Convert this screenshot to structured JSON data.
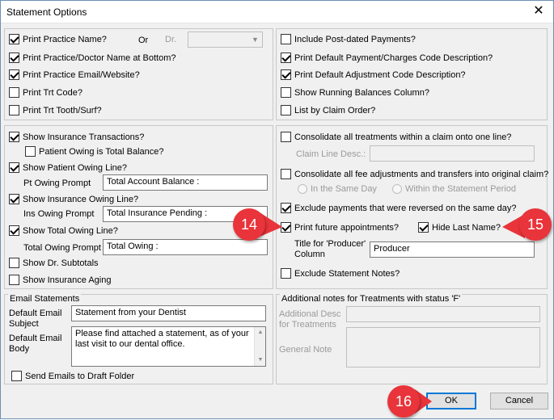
{
  "window": {
    "title": "Statement Options"
  },
  "top_left": {
    "print_practice_name": {
      "label": "Print Practice Name?",
      "checked": true
    },
    "or_label": "Or",
    "dr_label": "Dr.",
    "print_practice_doctor_bottom": {
      "label": "Print Practice/Doctor Name at Bottom?",
      "checked": true
    },
    "print_practice_email": {
      "label": "Print Practice Email/Website?",
      "checked": true
    },
    "print_trt_code": {
      "label": "Print Trt Code?",
      "checked": false
    },
    "print_trt_tooth": {
      "label": "Print Trt Tooth/Surf?",
      "checked": false
    }
  },
  "top_right": {
    "include_post_dated": {
      "label": "Include Post-dated Payments?",
      "checked": false
    },
    "print_default_payment": {
      "label": "Print Default Payment/Charges Code Description?",
      "checked": true
    },
    "print_default_adjustment": {
      "label": "Print Default Adjustment Code Description?",
      "checked": true
    },
    "show_running_balances": {
      "label": "Show Running Balances Column?",
      "checked": false
    },
    "list_by_claim_order": {
      "label": "List by Claim Order?",
      "checked": false
    }
  },
  "middle_left": {
    "show_insurance_transactions": {
      "label": "Show Insurance Transactions?",
      "checked": true
    },
    "patient_owing_total": {
      "label": "Patient Owing is Total Balance?",
      "checked": false
    },
    "show_patient_owing": {
      "label": "Show Patient Owing Line?",
      "checked": true
    },
    "pt_owing_prompt_label": "Pt Owing Prompt",
    "pt_owing_prompt_value": "Total Account Balance :",
    "show_insurance_owing": {
      "label": "Show Insurance Owing Line?",
      "checked": true
    },
    "ins_owing_prompt_label": "Ins Owing Prompt",
    "ins_owing_prompt_value": "Total Insurance Pending :",
    "show_total_owing": {
      "label": "Show Total Owing Line?",
      "checked": true
    },
    "total_owing_prompt_label": "Total Owing Prompt",
    "total_owing_prompt_value": "Total Owing :",
    "show_dr_subtotals": {
      "label": "Show Dr. Subtotals",
      "checked": false
    },
    "show_insurance_aging": {
      "label": "Show Insurance Aging",
      "checked": false
    }
  },
  "middle_right": {
    "consolidate_treatments": {
      "label": "Consolidate all treatments within a claim onto one line?",
      "checked": false
    },
    "claim_line_desc_label": "Claim Line Desc.:",
    "consolidate_fee_adjustments": {
      "label": "Consolidate all fee adjustments and transfers into original claim?",
      "checked": false
    },
    "radio_same_day": "In the Same Day",
    "radio_within_period": "Within the Statement Period",
    "exclude_reversed": {
      "label": "Exclude payments that were reversed on the same day?",
      "checked": true
    },
    "print_future_appointments": {
      "label": "Print future appointments?",
      "checked": true
    },
    "hide_last_name": {
      "label": "Hide Last Name?",
      "checked": true
    },
    "title_producer_label_1": "Title for 'Producer'",
    "title_producer_label_2": "Column",
    "title_producer_value": "Producer",
    "exclude_statement_notes": {
      "label": "Exclude Statement Notes?",
      "checked": false
    }
  },
  "email": {
    "group_title": "Email Statements",
    "subject_label_1": "Default Email",
    "subject_label_2": "Subject",
    "subject_value": "Statement from your Dentist",
    "body_label_1": "Default Email",
    "body_label_2": "Body",
    "body_value": "Please find attached a statement, as of your last visit to our dental office.",
    "send_to_draft": {
      "label": "Send Emails to Draft Folder",
      "checked": false
    }
  },
  "notes_f": {
    "group_title": "Additional notes for Treatments with status 'F'",
    "additional_desc_label_1": "Additional Desc",
    "additional_desc_label_2": "for Treatments",
    "general_note_label": "General Note"
  },
  "buttons": {
    "ok": "OK",
    "cancel": "Cancel"
  },
  "callouts": {
    "c14": "14",
    "c15": "15",
    "c16": "16"
  },
  "colors": {
    "callout": "#e8343a",
    "focus": "#0078d7"
  }
}
